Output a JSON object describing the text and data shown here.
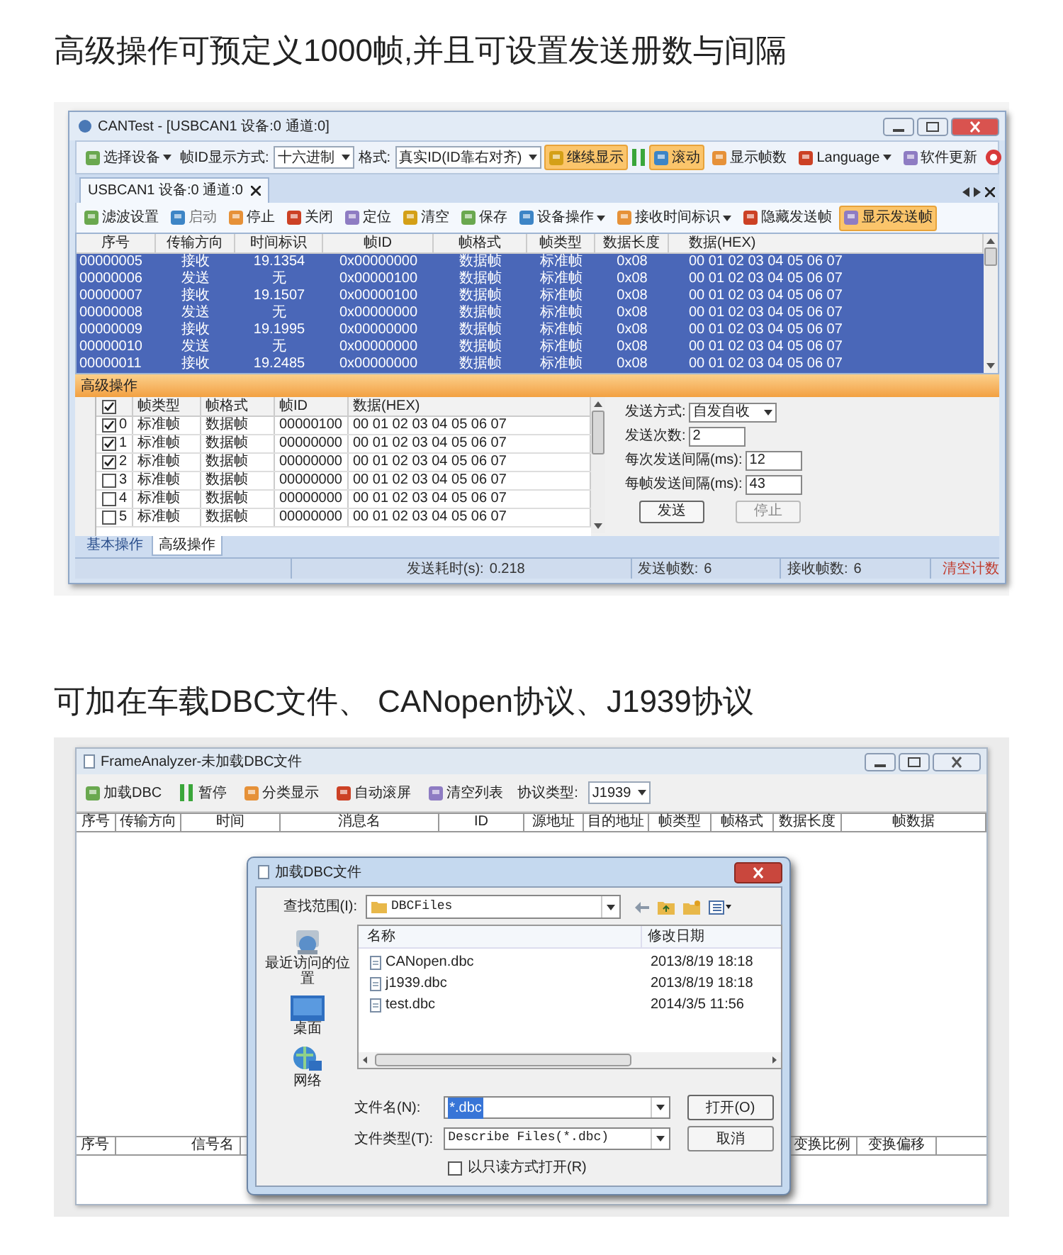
{
  "heading_1": "高级操作可预定义1000帧,并且可设置发送册数与间隔",
  "can_window": {
    "title": "CANTest - [USBCAN1 设备:0 通道:0]",
    "toolbar": [
      {
        "kind": "button",
        "label": "选择设备",
        "dropdown": true,
        "active": false,
        "disabled": false
      },
      {
        "kind": "label",
        "label": "帧ID显示方式:"
      },
      {
        "kind": "combo",
        "value": "十六进制"
      },
      {
        "kind": "label",
        "label": "格式:"
      },
      {
        "kind": "combo",
        "value": "真实ID(ID靠右对齐)"
      },
      {
        "kind": "button",
        "label": "继续显示",
        "dropdown": false,
        "active": true,
        "disabled": false
      },
      {
        "kind": "pause"
      },
      {
        "kind": "button",
        "label": "滚动",
        "dropdown": false,
        "active": true,
        "disabled": false
      },
      {
        "kind": "button",
        "label": "显示帧数",
        "dropdown": false,
        "active": false,
        "disabled": false
      },
      {
        "kind": "button",
        "label": "Language",
        "dropdown": true,
        "active": false,
        "disabled": false
      },
      {
        "kind": "button",
        "label": "软件更新",
        "dropdown": false,
        "active": false,
        "disabled": false
      },
      {
        "kind": "help"
      }
    ],
    "tabs": [
      {
        "label": "USBCAN1 设备:0 通道:0",
        "selected": true
      }
    ],
    "toolbar_2": [
      {
        "kind": "button",
        "label": "滤波设置",
        "dropdown": false,
        "active": false,
        "disabled": false
      },
      {
        "kind": "button",
        "label": "启动",
        "dropdown": false,
        "active": false,
        "disabled": true
      },
      {
        "kind": "button",
        "label": "停止",
        "dropdown": false,
        "active": false,
        "disabled": false
      },
      {
        "kind": "button",
        "label": "关闭",
        "dropdown": false,
        "active": false,
        "disabled": false
      },
      {
        "kind": "button",
        "label": "定位",
        "dropdown": false,
        "active": false,
        "disabled": false
      },
      {
        "kind": "button",
        "label": "清空",
        "dropdown": false,
        "active": false,
        "disabled": false
      },
      {
        "kind": "button",
        "label": "保存",
        "dropdown": false,
        "active": false,
        "disabled": false
      },
      {
        "kind": "button",
        "label": "设备操作",
        "dropdown": true,
        "active": false,
        "disabled": false
      },
      {
        "kind": "button",
        "label": "接收时间标识",
        "dropdown": true,
        "active": false,
        "disabled": false
      },
      {
        "kind": "button",
        "label": "隐藏发送帧",
        "dropdown": false,
        "active": false,
        "disabled": false
      },
      {
        "kind": "button",
        "label": "显示发送帧",
        "dropdown": false,
        "active": true,
        "disabled": false
      }
    ],
    "log_table": {
      "columns": [
        "序号",
        "传输方向",
        "时间标识",
        "帧ID",
        "帧格式",
        "帧类型",
        "数据长度",
        "数据(HEX)"
      ],
      "rows": [
        {
          "selected": true,
          "cells": [
            "00000005",
            "接收",
            "19.1354",
            "0x00000000",
            "数据帧",
            "标准帧",
            "0x08",
            "00 01 02 03 04 05 06 07"
          ]
        },
        {
          "selected": true,
          "cells": [
            "00000006",
            "发送",
            "无",
            "0x00000100",
            "数据帧",
            "标准帧",
            "0x08",
            "00 01 02 03 04 05 06 07"
          ]
        },
        {
          "selected": true,
          "cells": [
            "00000007",
            "接收",
            "19.1507",
            "0x00000100",
            "数据帧",
            "标准帧",
            "0x08",
            "00 01 02 03 04 05 06 07"
          ]
        },
        {
          "selected": true,
          "cells": [
            "00000008",
            "发送",
            "无",
            "0x00000000",
            "数据帧",
            "标准帧",
            "0x08",
            "00 01 02 03 04 05 06 07"
          ]
        },
        {
          "selected": true,
          "cells": [
            "00000009",
            "接收",
            "19.1995",
            "0x00000000",
            "数据帧",
            "标准帧",
            "0x08",
            "00 01 02 03 04 05 06 07"
          ]
        },
        {
          "selected": true,
          "cells": [
            "00000010",
            "发送",
            "无",
            "0x00000000",
            "数据帧",
            "标准帧",
            "0x08",
            "00 01 02 03 04 05 06 07"
          ]
        },
        {
          "selected": true,
          "cells": [
            "00000011",
            "接收",
            "19.2485",
            "0x00000000",
            "数据帧",
            "标准帧",
            "0x08",
            "00 01 02 03 04 05 06 07"
          ]
        }
      ]
    },
    "advanced_title": "高级操作",
    "send_table": {
      "all_checked": true,
      "columns": [
        "帧类型",
        "帧格式",
        "帧ID",
        "数据(HEX)"
      ],
      "rows": [
        {
          "checked": true,
          "index": "0",
          "cells": [
            "标准帧",
            "数据帧",
            "00000100",
            "00 01 02 03 04 05 06 07"
          ]
        },
        {
          "checked": true,
          "index": "1",
          "cells": [
            "标准帧",
            "数据帧",
            "00000000",
            "00 01 02 03 04 05 06 07"
          ]
        },
        {
          "checked": true,
          "index": "2",
          "cells": [
            "标准帧",
            "数据帧",
            "00000000",
            "00 01 02 03 04 05 06 07"
          ]
        },
        {
          "checked": false,
          "index": "3",
          "cells": [
            "标准帧",
            "数据帧",
            "00000000",
            "00 01 02 03 04 05 06 07"
          ]
        },
        {
          "checked": false,
          "index": "4",
          "cells": [
            "标准帧",
            "数据帧",
            "00000000",
            "00 01 02 03 04 05 06 07"
          ]
        },
        {
          "checked": false,
          "index": "5",
          "cells": [
            "标准帧",
            "数据帧",
            "00000000",
            "00 01 02 03 04 05 06 07"
          ]
        }
      ]
    },
    "send_form": [
      {
        "kind": "select",
        "label": "发送方式:",
        "value": "自发自收"
      },
      {
        "kind": "input",
        "label": "发送次数:",
        "value": "2"
      },
      {
        "kind": "input",
        "label": "每次发送间隔(ms):",
        "value": "12"
      },
      {
        "kind": "input",
        "label": "每帧发送间隔(ms):",
        "value": "43"
      }
    ],
    "send_buttons": [
      {
        "label": "发送",
        "disabled": false
      },
      {
        "label": "停止",
        "disabled": true
      }
    ],
    "bottom_tabs": [
      {
        "label": "基本操作",
        "selected": false
      },
      {
        "label": "高级操作",
        "selected": true
      }
    ],
    "status_bar": [
      {
        "label": "发送耗时(s):",
        "value": "0.218"
      },
      {
        "label": "发送帧数:",
        "value": "6"
      },
      {
        "label": "接收帧数:",
        "value": "6"
      }
    ],
    "clear_link": "清空计数"
  },
  "heading_2": "可加在车载DBC文件、 CANopen协议、J1939协议",
  "analyzer_window": {
    "title": "FrameAnalyzer-未加载DBC文件",
    "toolbar": [
      {
        "kind": "button",
        "label": "加载DBC"
      },
      {
        "kind": "pause",
        "label": "暂停"
      },
      {
        "kind": "button",
        "label": "分类显示"
      },
      {
        "kind": "button",
        "label": "自动滚屏"
      },
      {
        "kind": "button",
        "label": "清空列表"
      },
      {
        "kind": "label",
        "label": "协议类型:"
      },
      {
        "kind": "combo",
        "value": "J1939"
      }
    ],
    "columns": [
      "序号",
      "传输方向",
      "时间",
      "消息名",
      "ID",
      "源地址",
      "目的地址",
      "帧类型",
      "帧格式",
      "数据长度",
      "帧数据"
    ],
    "signal_columns_left": [
      "序号",
      "信号名"
    ],
    "signal_columns_right": [
      "变换比例",
      "变换偏移"
    ]
  },
  "dialog": {
    "title": "加载DBC文件",
    "look_in_label": "查找范围(I):",
    "look_in_value": "DBCFiles",
    "places": [
      {
        "kind": "recent",
        "label": "最近访问的位置"
      },
      {
        "kind": "desktop",
        "label": "桌面"
      },
      {
        "kind": "network",
        "label": "网络"
      }
    ],
    "columns": [
      "名称",
      "修改日期"
    ],
    "files": [
      {
        "name": "CANopen.dbc",
        "modified": "2013/8/19 18:18"
      },
      {
        "name": "j1939.dbc",
        "modified": "2013/8/19 18:18"
      },
      {
        "name": "test.dbc",
        "modified": "2014/3/5 11:56"
      }
    ],
    "file_name_label": "文件名(N):",
    "file_name_value": "*.dbc",
    "file_name_selected": true,
    "file_type_label": "文件类型(T):",
    "file_type_value": "Describe Files(*.dbc)",
    "buttons": [
      "打开(O)",
      "取消"
    ],
    "read_only": {
      "label": "以只读方式打开(R)",
      "checked": false
    }
  }
}
